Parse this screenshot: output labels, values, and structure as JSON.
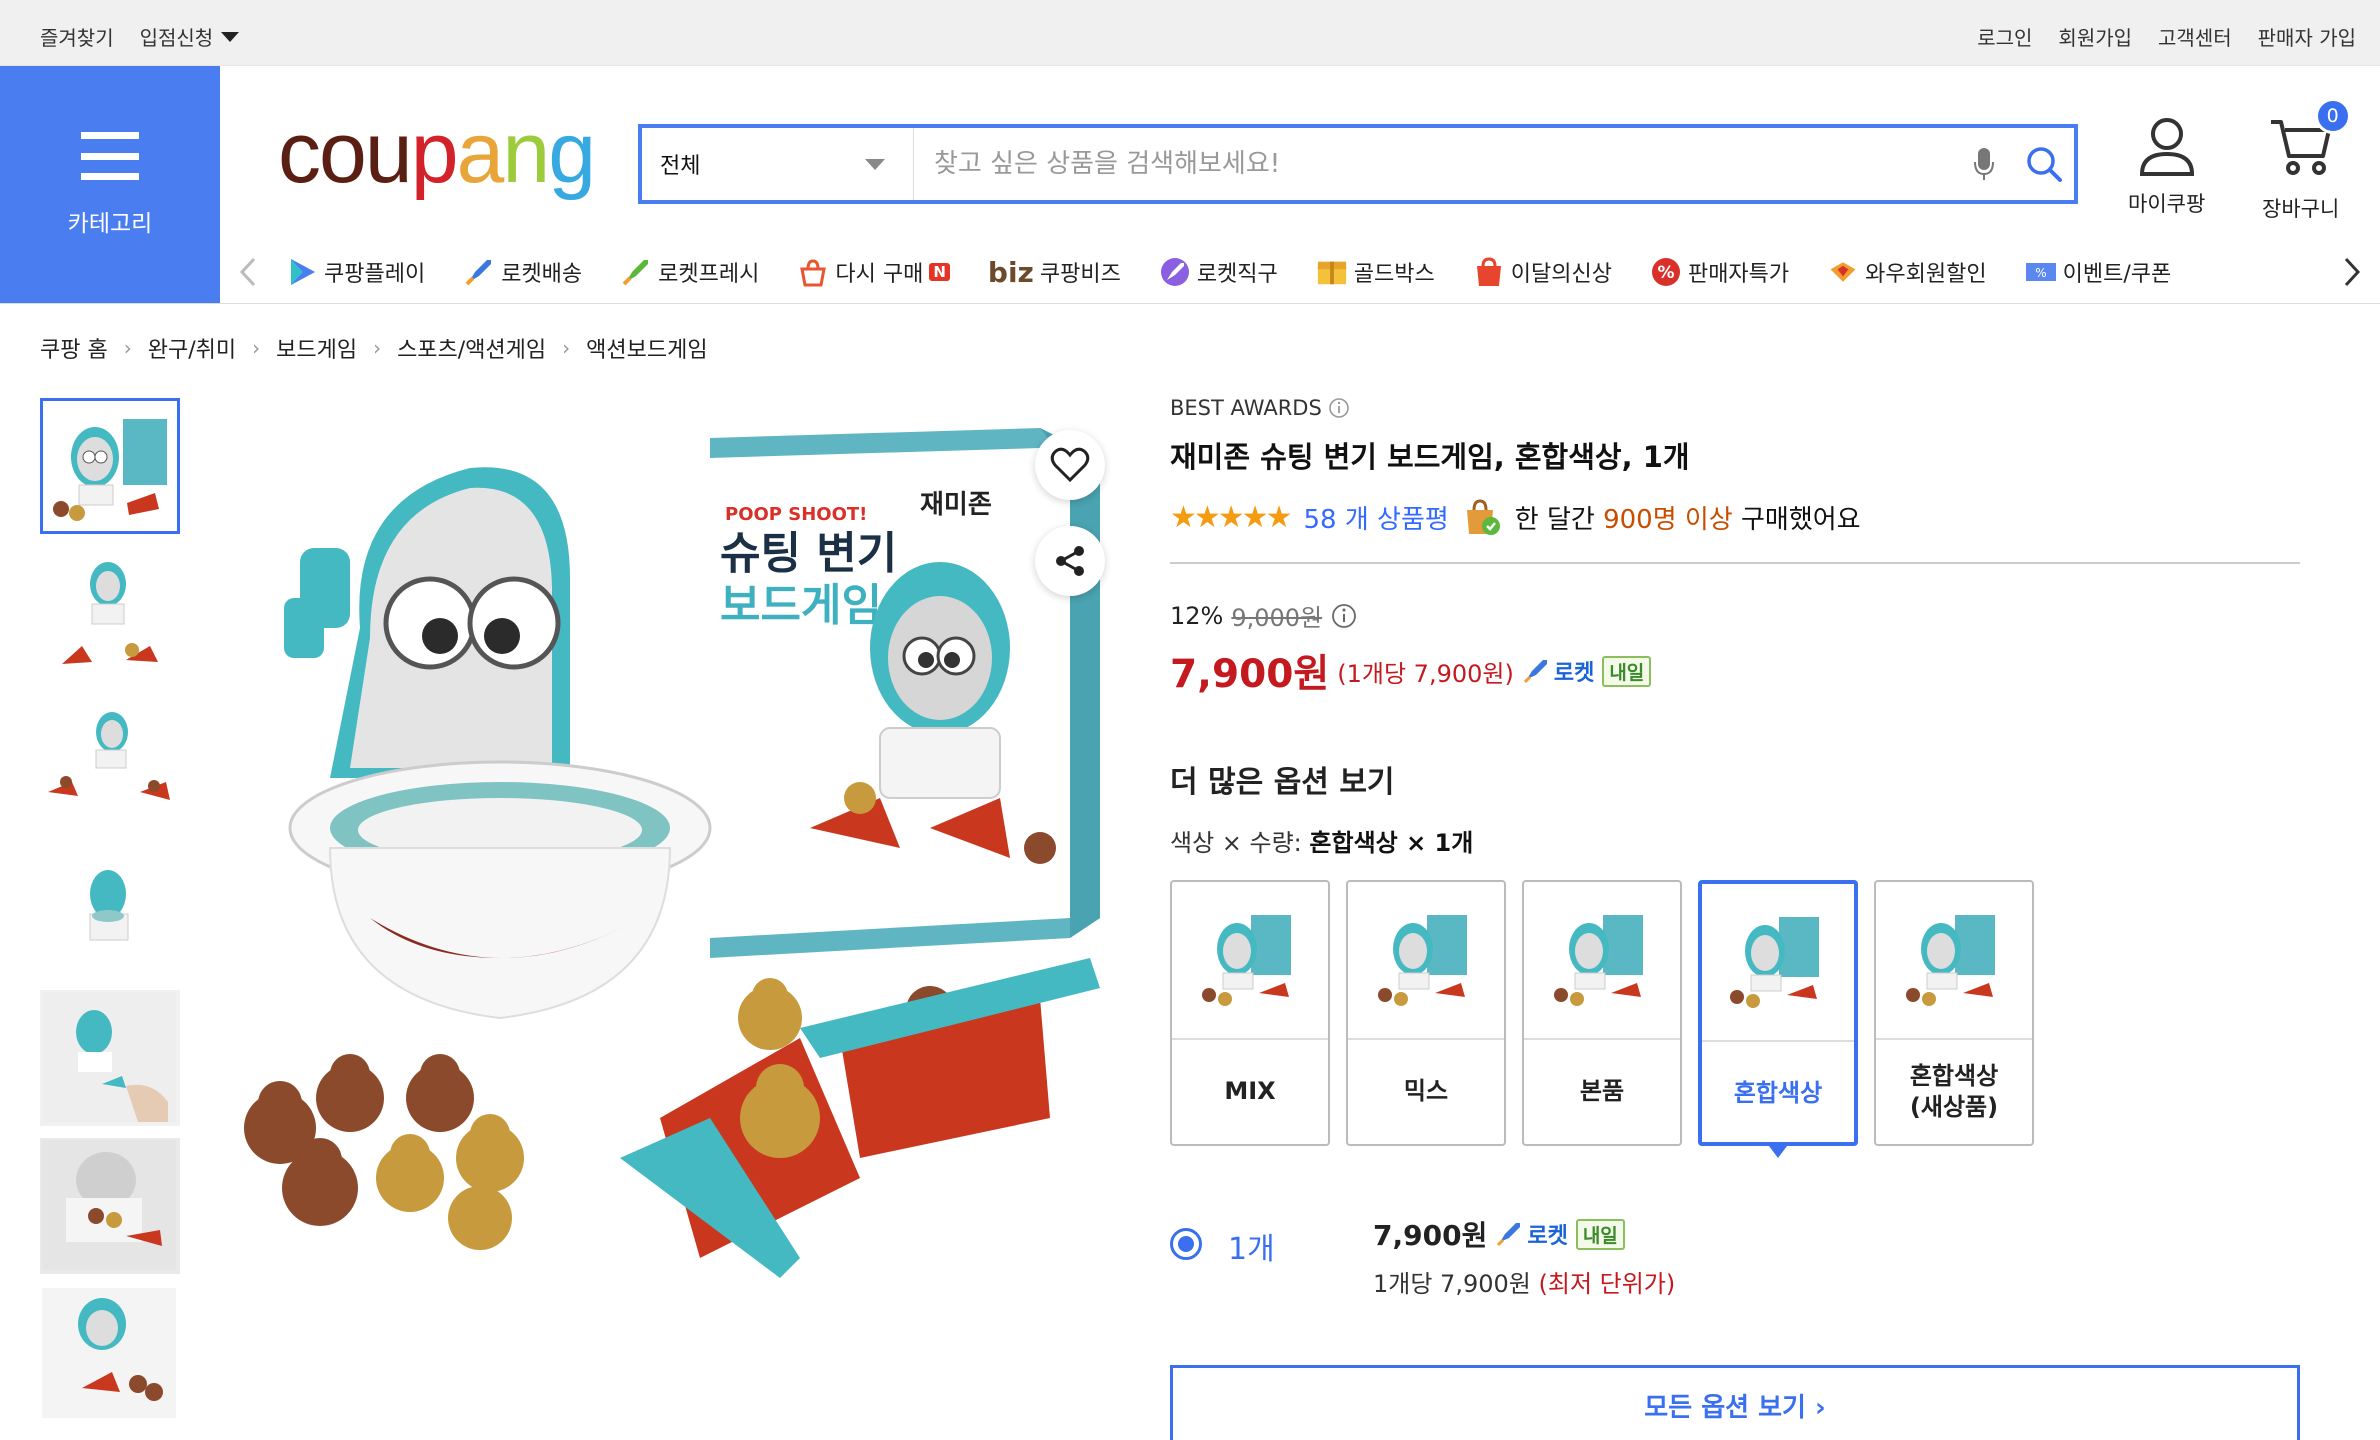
{
  "topbar": {
    "favorites": "즐겨찾기",
    "register": "입점신청",
    "right": [
      "로그인",
      "회원가입",
      "고객센터",
      "판매자 가입"
    ]
  },
  "category_button": {
    "label": "카테고리"
  },
  "logo": {
    "letters": [
      "c",
      "o",
      "u",
      "p",
      "a",
      "n",
      "g"
    ]
  },
  "search": {
    "category": "전체",
    "placeholder": "찾고 싶은 상품을 검색해보세요!"
  },
  "header": {
    "mycoupang": "마이쿠팡",
    "cart": "장바구니",
    "cart_count": "0"
  },
  "nav": [
    {
      "label": "쿠팡플레이",
      "icon": "play-icon"
    },
    {
      "label": "로켓배송",
      "icon": "rocket-icon"
    },
    {
      "label": "로켓프레시",
      "icon": "rocket-fresh-icon"
    },
    {
      "label": "다시 구매",
      "icon": "rebuy-icon",
      "badge": "N"
    },
    {
      "label": "쿠팡비즈",
      "icon": "biz-icon",
      "prefix": "biz"
    },
    {
      "label": "로켓직구",
      "icon": "rocket-global-icon"
    },
    {
      "label": "골드박스",
      "icon": "goldbox-icon"
    },
    {
      "label": "이달의신상",
      "icon": "new-icon"
    },
    {
      "label": "판매자특가",
      "icon": "percent-icon"
    },
    {
      "label": "와우회원할인",
      "icon": "wow-icon"
    },
    {
      "label": "이벤트/쿠폰",
      "icon": "coupon-icon"
    }
  ],
  "breadcrumb": [
    "쿠팡 홈",
    "완구/취미",
    "보드게임",
    "스포츠/액션게임",
    "액션보드게임"
  ],
  "product": {
    "award": "BEST AWARDS",
    "title": "재미존 슈팅 변기 보드게임, 혼합색상, 1개",
    "stars": "★★★★★",
    "rating": 5,
    "reviews": "58 개 상품평",
    "sold_pre": "한 달간",
    "sold_count": "900명 이상",
    "sold_post": "구매했어요",
    "discount": "12%",
    "original_price": "9,000원",
    "price": "7,900원",
    "unit_price": "(1개당 7,900원)",
    "rocket": "로켓",
    "naeil": "내일",
    "box_title_small": "POOP SHOOT!",
    "box_brand": "재미존",
    "box_title_1": "슈팅 변기",
    "box_title_2": "보드게임"
  },
  "options": {
    "header": "더 많은 옵션 보기",
    "selected_label": "색상 × 수량:",
    "selected_value": "혼합색상 × 1개",
    "items": [
      {
        "name": "MIX",
        "active": false
      },
      {
        "name": "믹스",
        "active": false
      },
      {
        "name": "본품",
        "active": false
      },
      {
        "name": "혼합색상",
        "active": true
      },
      {
        "name": "혼합색상\n(새상품)",
        "active": false
      }
    ]
  },
  "quantity": {
    "qty": "1개",
    "price": "7,900원",
    "rocket": "로켓",
    "naeil": "내일",
    "unit": "1개당 7,900원",
    "lowest": "(최저 단위가)"
  },
  "all_options": "모든 옵션 보기 ›",
  "colors": {
    "accent": "#346aff",
    "price": "#c4191f",
    "category_bg": "#4a7df0",
    "toilet_teal": "#45b9c1",
    "poop_brown": "#8b4a2b",
    "poop_gold": "#c89a3e",
    "base_red": "#c8371e"
  }
}
